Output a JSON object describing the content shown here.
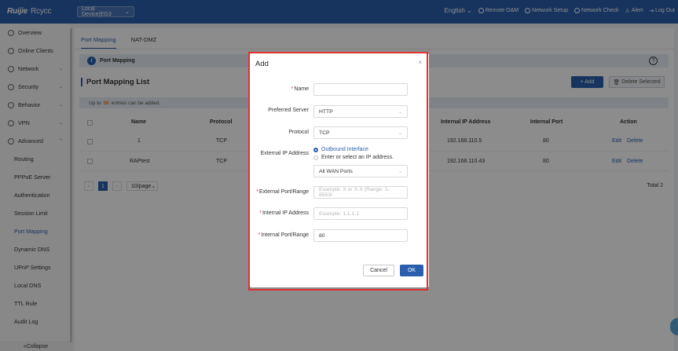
{
  "header": {
    "logo": "Ruijie",
    "logo_sub": "Rcycc",
    "device": "Local Device(EG3",
    "language": "English",
    "nav": [
      "Remote O&M",
      "Network Setup",
      "Network Check",
      "Alert",
      "Log Out"
    ]
  },
  "sidebar": {
    "items": [
      {
        "label": "Overview",
        "icon": "overview-icon"
      },
      {
        "label": "Online Clients",
        "icon": "clients-icon"
      },
      {
        "label": "Network",
        "icon": "network-icon"
      },
      {
        "label": "Security",
        "icon": "security-icon"
      },
      {
        "label": "Behavior",
        "icon": "behavior-icon"
      },
      {
        "label": "VPN",
        "icon": "vpn-icon"
      },
      {
        "label": "Advanced",
        "icon": "advanced-icon"
      }
    ],
    "subitems": [
      "Routing",
      "PPPoE Server",
      "Authentication",
      "Session Limit",
      "Port Mapping",
      "Dynamic DNS",
      "UPnP Settings",
      "Local DNS",
      "TTL Rule",
      "Audit Log"
    ],
    "active_sub": "Port Mapping",
    "collapse": "«Collapse"
  },
  "main": {
    "tabs": [
      "Port Mapping",
      "NAT-DMZ"
    ],
    "banner": "Port Mapping",
    "list_title": "Port Mapping List",
    "add_btn": "+ Add",
    "delete_btn": "Delete Selected",
    "limit_pre": "Up to",
    "limit_num": "50",
    "limit_post": "entries can be added.",
    "columns": [
      "Name",
      "Protocol",
      "Internal IP Address",
      "Internal Port",
      "Action"
    ],
    "rows": [
      {
        "name": "1",
        "protocol": "TCP",
        "ip": "192.168.110.5",
        "port": "80",
        "edit": "Edit",
        "delete": "Delete"
      },
      {
        "name": "RAPtest",
        "protocol": "TCP",
        "ip": "192.168.110.43",
        "port": "80",
        "edit": "Edit",
        "delete": "Delete"
      }
    ],
    "page": "1",
    "page_size": "10/page",
    "total": "Total 2"
  },
  "dialog": {
    "title": "Add",
    "close": "×",
    "name_label": "Name",
    "name_value": "",
    "server_label": "Preferred Server",
    "server_value": "HTTP",
    "protocol_label": "Protocol",
    "protocol_value": "TCP",
    "ext_ip_label": "External IP Address",
    "radio1": "Outbound Interface",
    "radio2": "Enter or select an IP address.",
    "wan_value": "All WAN Ports",
    "ext_port_label": "External Port/Range",
    "ext_port_placeholder": "Example: X or X-X (Range: 1-6553!",
    "int_ip_label": "Internal IP Address",
    "int_ip_placeholder": "Example: 1.1.1.1",
    "int_port_label": "Internal Port/Range",
    "int_port_value": "80",
    "cancel": "Cancel",
    "ok": "OK"
  }
}
